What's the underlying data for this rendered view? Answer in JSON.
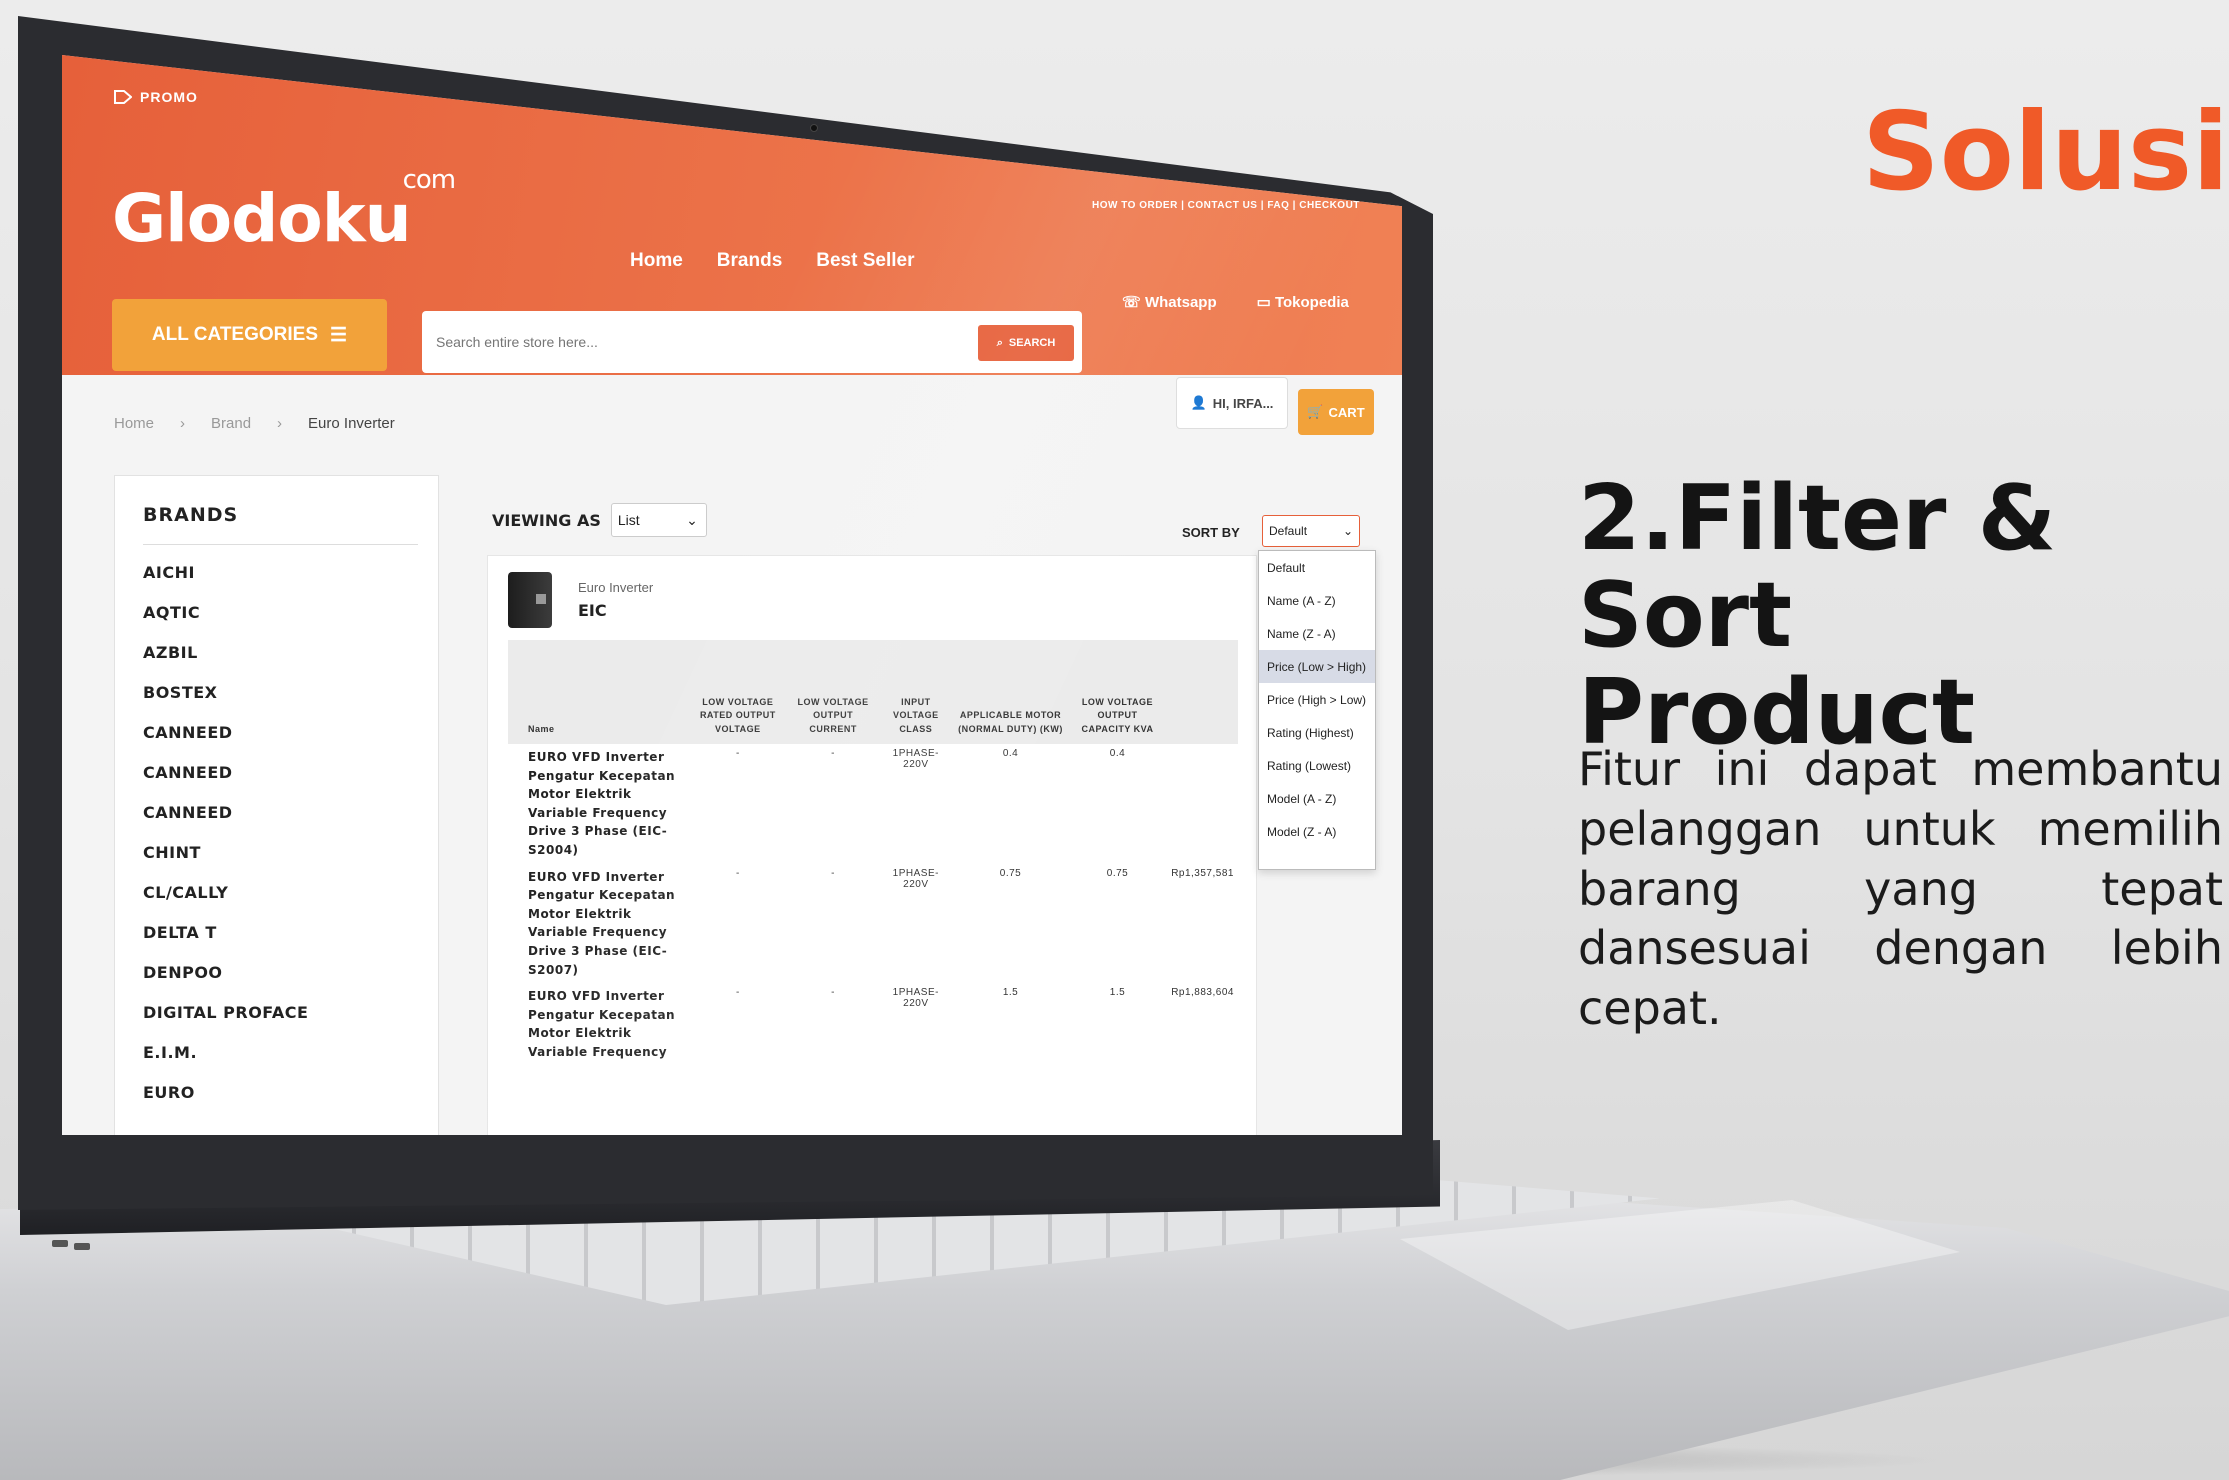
{
  "colors": {
    "brand_orange": "#f05a28",
    "header_orange": "#e6603a",
    "accent_yellow": "#f2a23a"
  },
  "headline": {
    "solusi": "Solusi",
    "feature_title": "2.Filter & Sort\nProduct",
    "feature_desc": "Fitur ini dapat membantu pelanggan untuk memilih barang yang tepat dansesuai dengan lebih cepat."
  },
  "site": {
    "promo": "PROMO",
    "logo_text": "Glodoku",
    "logo_sup": "com",
    "top_links": "HOW TO ORDER | CONTACT US | FAQ | CHECKOUT",
    "nav": [
      "Home",
      "Brands",
      "Best Seller"
    ],
    "contact": {
      "whatsapp": "Whatsapp",
      "tokopedia": "Tokopedia"
    },
    "all_categories": "ALL CATEGORIES",
    "search_placeholder": "Search entire store here...",
    "search_button": "SEARCH",
    "account": "HI, IRFA...",
    "cart": "CART",
    "breadcrumb": [
      "Home",
      "Brand",
      "Euro Inverter"
    ],
    "brands_title": "BRANDS",
    "brands": [
      "AICHI",
      "AQTIC",
      "AZBIL",
      "BOSTEX",
      "CANNEED",
      "CANNEED",
      "CANNEED",
      "CHINT",
      "CL/CALLY",
      "DELTA T",
      "DENPOO",
      "DIGITAL PROFACE",
      "E.I.M.",
      "EURO"
    ],
    "viewing_as": "VIEWING AS",
    "view_mode": "List",
    "sort_by": "SORT BY",
    "sort_value": "Default",
    "sort_options": [
      "Default",
      "Name (A - Z)",
      "Name (Z - A)",
      "Price (Low > High)",
      "Price (High > Low)",
      "Rating (Highest)",
      "Rating (Lowest)",
      "Model (A - Z)",
      "Model (Z - A)"
    ],
    "product": {
      "category": "Euro Inverter",
      "name": "EIC",
      "headers": [
        "Name",
        "LOW VOLTAGE RATED OUTPUT VOLTAGE",
        "LOW VOLTAGE OUTPUT CURRENT",
        "INPUT VOLTAGE CLASS",
        "APPLICABLE MOTOR (NORMAL DUTY) (KW)",
        "LOW VOLTAGE OUTPUT CAPACITY KVA",
        ""
      ],
      "rows": [
        {
          "name": "EURO VFD Inverter Pengatur Kecepatan Motor Elektrik Variable Frequency Drive 3 Phase (EIC-S2004)",
          "c1": "-",
          "c2": "-",
          "c3": "1PHASE-220V",
          "c4": "0.4",
          "c5": "0.4",
          "c6": ""
        },
        {
          "name": "EURO VFD Inverter Pengatur Kecepatan Motor Elektrik Variable Frequency Drive 3 Phase (EIC-S2007)",
          "c1": "-",
          "c2": "-",
          "c3": "1PHASE-220V",
          "c4": "0.75",
          "c5": "0.75",
          "c6": "Rp1,357,581"
        },
        {
          "name": "EURO VFD Inverter Pengatur Kecepatan Motor Elektrik Variable Frequency",
          "c1": "-",
          "c2": "-",
          "c3": "1PHASE-220V",
          "c4": "1.5",
          "c5": "1.5",
          "c6": "Rp1,883,604"
        }
      ]
    }
  }
}
